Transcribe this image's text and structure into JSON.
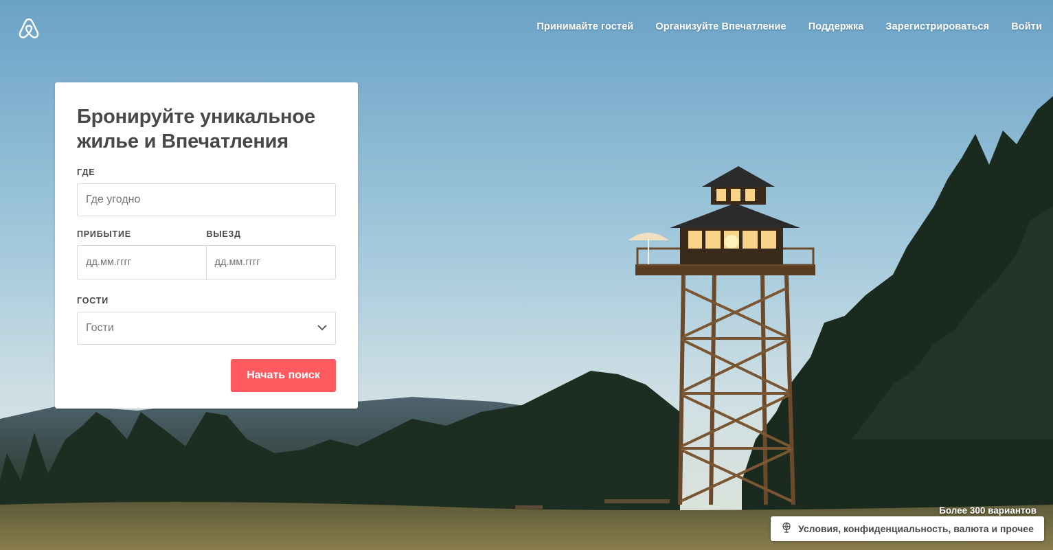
{
  "brand": {
    "logo_icon": "airbnb-belo-icon",
    "color": "#ff5a5f"
  },
  "nav": {
    "items": [
      "Принимайте гостей",
      "Организуйте Впечатление",
      "Поддержка",
      "Зарегистрироваться",
      "Войти"
    ]
  },
  "search": {
    "title": "Бронируйте уникальное жилье и Впечатления",
    "where_label": "Где",
    "where_placeholder": "Где угодно",
    "checkin_label": "Прибытие",
    "checkin_placeholder": "дд.мм.гггг",
    "checkout_label": "Выезд",
    "checkout_placeholder": "дд.мм.гггг",
    "guests_label": "Гости",
    "guests_value": "Гости",
    "guests_icon": "chevron-down-icon",
    "submit_label": "Начать поиск"
  },
  "footer": {
    "count_text": "Более 300 вариантов",
    "terms_icon": "globe-icon",
    "terms_label": "Условия, конфиденциальность, валюта и прочее"
  }
}
